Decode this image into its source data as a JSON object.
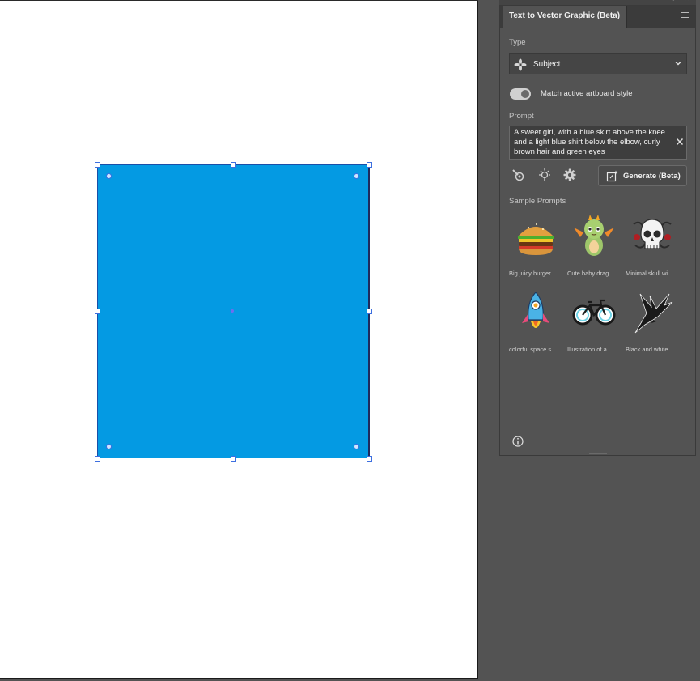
{
  "panel": {
    "tab_title": "Text to Vector Graphic (Beta)",
    "type_label": "Type",
    "type_value": "Subject",
    "toggle_label": "Match active artboard style",
    "prompt_label": "Prompt",
    "prompt_text": "A sweet girl, with a blue skirt above the knee and a light blue shirt below the elbow, curly brown hair and green eyes",
    "generate_label": "Generate (Beta)",
    "samples_label": "Sample Prompts",
    "samples": [
      {
        "caption": "Big juicy burger...",
        "icon": "burger-thumbnail"
      },
      {
        "caption": "Cute baby drag...",
        "icon": "dragon-thumbnail"
      },
      {
        "caption": "Minimal skull wi...",
        "icon": "skull-thumbnail"
      },
      {
        "caption": "colorful space s...",
        "icon": "rocket-thumbnail"
      },
      {
        "caption": "Illustration of a...",
        "icon": "bicycle-thumbnail"
      },
      {
        "caption": "Black and white...",
        "icon": "bird-thumbnail"
      }
    ]
  },
  "colors": {
    "shape_fill": "#049ae3",
    "panel_bg": "#535353",
    "selection_blue": "#3d6fe0"
  }
}
